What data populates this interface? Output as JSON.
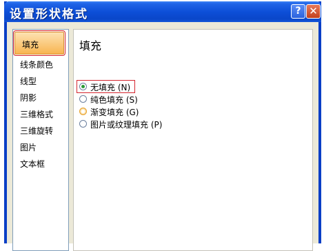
{
  "window": {
    "title": "设置形状格式"
  },
  "titlebar": {
    "help_glyph": "?",
    "close_glyph": "✕"
  },
  "sidebar": {
    "items": [
      {
        "label": "填充",
        "selected": true
      },
      {
        "label": "线条颜色"
      },
      {
        "label": "线型"
      },
      {
        "label": "阴影"
      },
      {
        "label": "三维格式"
      },
      {
        "label": "三维旋转"
      },
      {
        "label": "图片"
      },
      {
        "label": "文本框"
      }
    ]
  },
  "main": {
    "section_title": "填充",
    "fill_options": [
      {
        "label": "无填充 (N)",
        "checked": true
      },
      {
        "label": "纯色填充 (S)"
      },
      {
        "label": "渐变填充 (G)"
      },
      {
        "label": "图片或纹理填充 (P)"
      }
    ]
  },
  "colors": {
    "selection_accent": "#f8b551",
    "highlight_border": "#d4232d",
    "titlebar": "#0d4fd8"
  }
}
